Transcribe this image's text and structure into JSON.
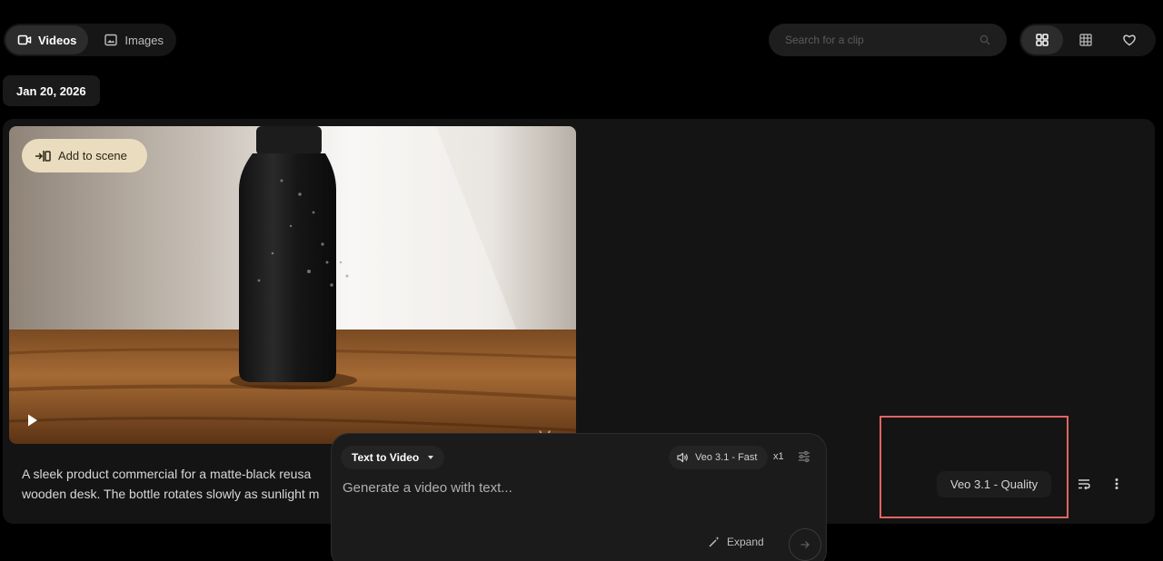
{
  "tabs": {
    "videos_label": "Videos",
    "images_label": "Images",
    "videos_icon": "video-camera-icon",
    "images_icon": "image-icon"
  },
  "search": {
    "placeholder": "Search for a clip",
    "icon": "search-icon"
  },
  "view_toggles": [
    "grid-large-icon",
    "grid-small-icon",
    "heart-icon"
  ],
  "date_group": "Jan 20, 2026",
  "clip": {
    "add_to_scene_label": "Add to scene",
    "watermark": "Veo",
    "description": "A sleek product commercial for a matte-black reusable water bottle sitting on a wooden desk. The bottle rotates slowly as sunlight moves across it.",
    "description_line1": "A sleek product commercial for a matte-black reusa",
    "description_line2": "wooden desk. The bottle rotates slowly as sunlight m",
    "model_badge": "Veo 3.1 - Quality"
  },
  "composer": {
    "mode_label": "Text to Video",
    "model_label": "Veo 3.1 - Fast",
    "count_label": "x1",
    "prompt_placeholder": "Generate a video with text...",
    "expand_label": "Expand"
  },
  "colors": {
    "background": "#000000",
    "card": "#141414",
    "add_to_scene": "#eadcbe",
    "highlight": "#e06662"
  }
}
